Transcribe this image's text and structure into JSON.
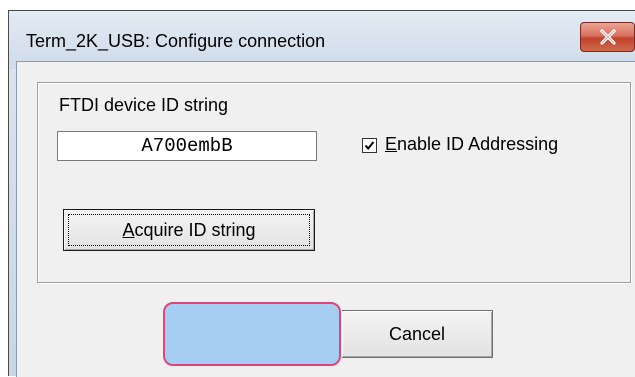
{
  "window": {
    "title": "Term_2K_USB: Configure connection",
    "close_icon": "close-x-icon"
  },
  "group": {
    "label": "FTDI device ID string"
  },
  "id_input": {
    "value": "A700embB"
  },
  "enable_id_addressing": {
    "label_prefix": "E",
    "label_rest": "nable ID Addressing",
    "checked": true
  },
  "acquire_button": {
    "label_prefix": "A",
    "label_rest": "cquire ID string"
  },
  "ok_button": {
    "label": ""
  },
  "cancel_button": {
    "label": "Cancel"
  },
  "colors": {
    "close_button": "#c94a33",
    "highlight_fill": "#a6cef2",
    "highlight_border": "#e0457a"
  }
}
